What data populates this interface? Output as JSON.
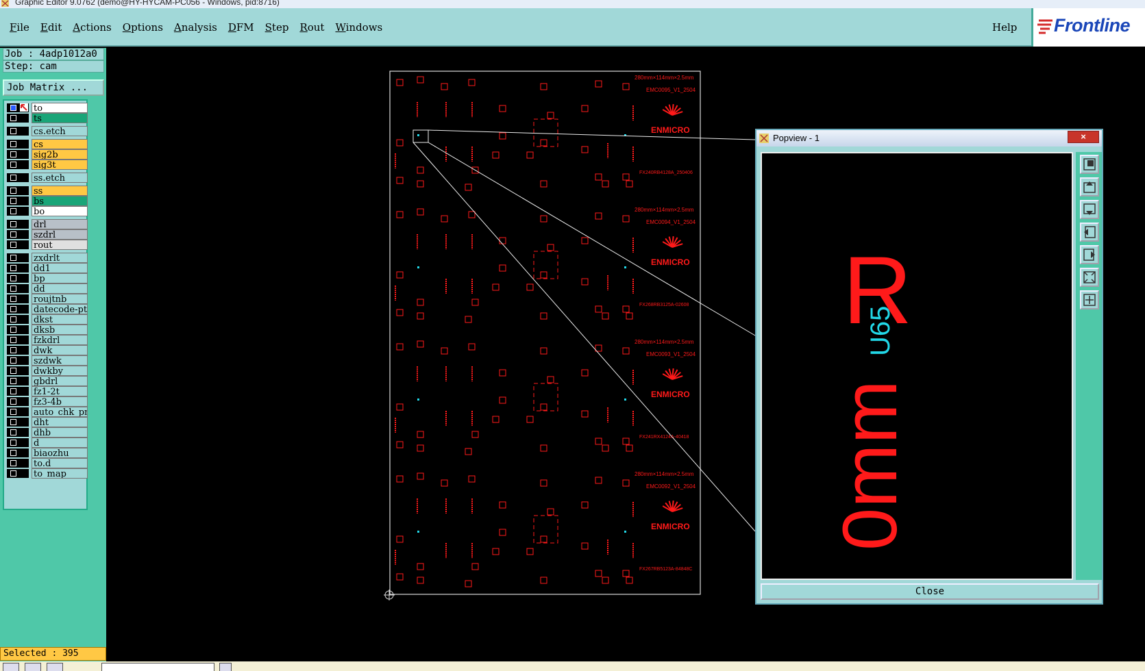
{
  "window": {
    "title": "Graphic Editor 9.0762 (demo@HY-HYCAM-PC056 - Windows, pid:8716)"
  },
  "menu": {
    "items": [
      "File",
      "Edit",
      "Actions",
      "Options",
      "Analysis",
      "DFM",
      "Step",
      "Rout",
      "Windows"
    ],
    "help": "Help"
  },
  "logo": {
    "text": "Frontline"
  },
  "job": {
    "job_label": "Job : 4adp1012a0",
    "step_label": "Step: cam",
    "matrix_button": "Job Matrix ..."
  },
  "layers": [
    {
      "name": "to",
      "color": "#ffffff"
    },
    {
      "name": "ts",
      "color": "#1aa578"
    },
    {
      "name": "cs.etch",
      "color": "#a1d8d8"
    },
    {
      "name": "cs",
      "color": "#ffc844"
    },
    {
      "name": "sig2b",
      "color": "#ffc844"
    },
    {
      "name": "sig3t",
      "color": "#ffc844"
    },
    {
      "name": "ss.etch",
      "color": "#a1d8d8"
    },
    {
      "name": "ss",
      "color": "#ffc844"
    },
    {
      "name": "bs",
      "color": "#1aa578"
    },
    {
      "name": "bo",
      "color": "#ffffff"
    },
    {
      "name": "drl",
      "color": "#b8c0c8"
    },
    {
      "name": "szdrl",
      "color": "#b8c0c8"
    },
    {
      "name": "rout",
      "color": "#e0e0e0"
    },
    {
      "name": "zxdrlt",
      "color": "#a1d8d8"
    },
    {
      "name": "dd1",
      "color": "#a1d8d8"
    },
    {
      "name": "bp",
      "color": "#a1d8d8"
    },
    {
      "name": "dd",
      "color": "#a1d8d8"
    },
    {
      "name": "roujtnb",
      "color": "#a1d8d8"
    },
    {
      "name": "datecode-pte",
      "color": "#a1d8d8"
    },
    {
      "name": "dkst",
      "color": "#a1d8d8"
    },
    {
      "name": "dksb",
      "color": "#a1d8d8"
    },
    {
      "name": "fzkdrl",
      "color": "#a1d8d8"
    },
    {
      "name": "dwk",
      "color": "#a1d8d8"
    },
    {
      "name": "szdwk",
      "color": "#a1d8d8"
    },
    {
      "name": "dwkby",
      "color": "#a1d8d8"
    },
    {
      "name": "gbdrl",
      "color": "#a1d8d8"
    },
    {
      "name": "fz1-2t",
      "color": "#a1d8d8"
    },
    {
      "name": "fz3-4b",
      "color": "#a1d8d8"
    },
    {
      "name": "auto_chk_pnl",
      "color": "#a1d8d8"
    },
    {
      "name": "dht",
      "color": "#a1d8d8"
    },
    {
      "name": "dhb",
      "color": "#a1d8d8"
    },
    {
      "name": "d",
      "color": "#a1d8d8"
    },
    {
      "name": "biaozhu",
      "color": "#a1d8d8"
    },
    {
      "name": "to.d",
      "color": "#a1d8d8"
    },
    {
      "name": "to_map",
      "color": "#a1d8d8"
    }
  ],
  "status": {
    "selected": "Selected : 395"
  },
  "board": {
    "panels": [
      {
        "size_text": "280mm×114mm×2.5mm",
        "emc_text": "EMC0095_V1_2504",
        "brand": "ENMICRO",
        "part_text": "FX240RB4128A_250406"
      },
      {
        "size_text": "280mm×114mm×2.5mm",
        "emc_text": "EMC0094_V1_2504",
        "brand": "ENMICRO",
        "part_text": "FX268RB3125A-02608"
      },
      {
        "size_text": "280mm×114mm×2.5mm",
        "emc_text": "EMC0093_V1_2504",
        "brand": "ENMICRO",
        "part_text": "FX241RX4124A-40418"
      },
      {
        "size_text": "280mm×114mm×2.5mm",
        "emc_text": "EMC0092_V1_2504",
        "brand": "ENMICRO",
        "part_text": "FX267RB5123A-84848C"
      }
    ]
  },
  "popview": {
    "title": "Popview - 1",
    "close_x": "×",
    "close_button": "Close",
    "zoom_big_text": "R",
    "zoom_rotated_text": "0mm",
    "zoom_cyan_text": "U65"
  },
  "colors": {
    "panel": "#a1d8d8",
    "accent": "#4fc8a8",
    "board_red": "#ff1a1a"
  },
  "icons": [
    "zoom-icon",
    "pan-up-icon",
    "pan-down-icon",
    "pan-left-icon",
    "pan-right-icon",
    "fit-icon",
    "home-icon"
  ]
}
